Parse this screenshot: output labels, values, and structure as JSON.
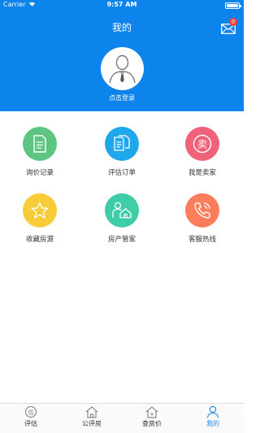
{
  "status_bar": {
    "carrier": "Carrier",
    "time": "9:57 AM"
  },
  "header": {
    "title": "我的",
    "mail_badge": "0",
    "login_text": "点击登录"
  },
  "grid": [
    {
      "label": "询价记录",
      "color": "#5dc582",
      "icon": "document-icon"
    },
    {
      "label": "评估订单",
      "color": "#1fa7ec",
      "icon": "documents-icon"
    },
    {
      "label": "我是卖家",
      "color": "#f0627a",
      "icon": "sell-icon",
      "glyph": "卖"
    },
    {
      "label": "收藏房源",
      "color": "#f8cb38",
      "icon": "star-icon"
    },
    {
      "label": "房产管家",
      "color": "#3ecda6",
      "icon": "house-person-icon"
    },
    {
      "label": "客服热线",
      "color": "#fb7d5b",
      "icon": "phone-icon"
    }
  ],
  "tabs": [
    {
      "label": "评估",
      "icon": "appraise-icon",
      "glyph": "估"
    },
    {
      "label": "公评房",
      "icon": "house-icon"
    },
    {
      "label": "查房价",
      "icon": "price-house-icon",
      "glyph": "¥"
    },
    {
      "label": "我的",
      "icon": "person-icon",
      "active": true
    }
  ],
  "colors": {
    "header_bg": "#0d83ec",
    "tab_active": "#1e88e5"
  }
}
